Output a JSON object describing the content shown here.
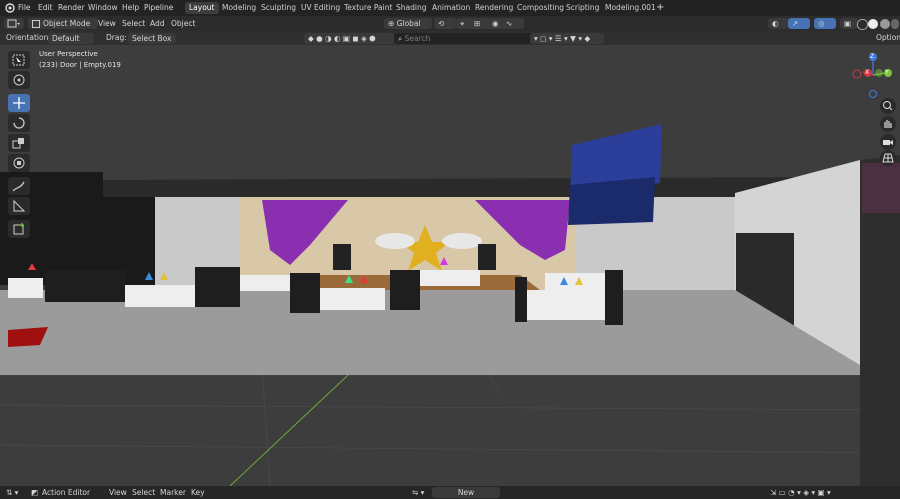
{
  "menu": {
    "items": [
      "File",
      "Edit",
      "Render",
      "Window",
      "Help",
      "Pipeline"
    ]
  },
  "workspaces": {
    "tabs": [
      "Layout",
      "Modeling",
      "Sculpting",
      "UV Editing",
      "Texture Paint",
      "Shading",
      "Animation",
      "Rendering",
      "Compositing",
      "Scripting",
      "Modeling.001"
    ],
    "active": "Layout",
    "add": "+"
  },
  "header": {
    "mode": "Object Mode",
    "menus": [
      "View",
      "Select",
      "Add",
      "Object"
    ],
    "transform_orientation": "Global"
  },
  "tool_settings": {
    "orientation_label": "Orientation:",
    "orientation_value": "Default",
    "drag_label": "Drag:",
    "drag_value": "Select Box",
    "search_placeholder": "Search",
    "options": "Options"
  },
  "viewport": {
    "perspective": "User Perspective",
    "object_info": "(233) Door | Empty.019"
  },
  "gizmo": {
    "z": "Z",
    "y": "Y",
    "x": "X"
  },
  "bottom": {
    "editor": "Action Editor",
    "menus": [
      "View",
      "Select",
      "Marker",
      "Key"
    ],
    "new": "New"
  },
  "colors": {
    "accent": "#4772b3",
    "x_axis": "#d7343f",
    "y_axis": "#7bc23d",
    "z_axis": "#3d7be0"
  }
}
